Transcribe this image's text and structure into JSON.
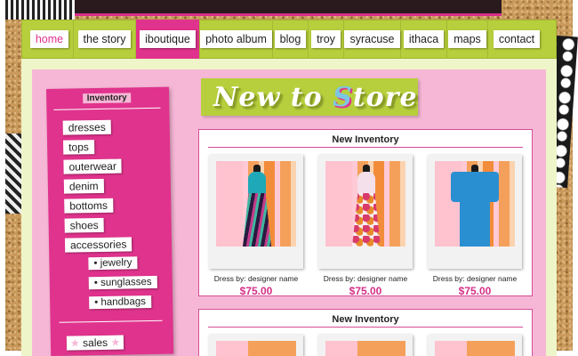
{
  "nav": {
    "items": [
      {
        "label": "home",
        "active": false
      },
      {
        "label": "the story",
        "active": false
      },
      {
        "label": "iboutique",
        "active": true
      },
      {
        "label": "photo album",
        "active": false
      },
      {
        "label": "blog",
        "active": false
      },
      {
        "label": "troy",
        "active": false
      },
      {
        "label": "syracuse",
        "active": false
      },
      {
        "label": "ithaca",
        "active": false
      },
      {
        "label": "maps",
        "active": false
      },
      {
        "label": "contact",
        "active": false
      }
    ]
  },
  "sidebar": {
    "heading": "Inventory",
    "categories": [
      "dresses",
      "tops",
      "outerwear",
      "denim",
      "bottoms",
      "shoes",
      "accessories"
    ],
    "subcategories": [
      "• jewelry",
      "• sunglasses",
      "• handbags"
    ],
    "sales_label": "sales"
  },
  "banner": {
    "part1": "New to ",
    "highlight": "S",
    "part2": "tore"
  },
  "inventory_sections": [
    {
      "title": "New Inventory",
      "products": [
        {
          "name": "Dress by: designer name",
          "price": "$75.00"
        },
        {
          "name": "Dress by: designer name",
          "price": "$75.00"
        },
        {
          "name": "Dress by: designer name",
          "price": "$75.00"
        }
      ]
    },
    {
      "title": "New Inventory"
    }
  ],
  "colors": {
    "accent_pink": "#e0338d",
    "lime": "#b7cf3c",
    "panel_pink": "#f6b7d6",
    "price_pink": "#d42f86"
  }
}
